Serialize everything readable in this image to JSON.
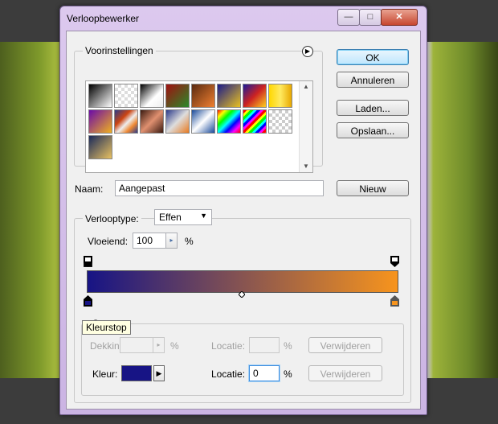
{
  "window": {
    "title": "Verloopbewerker"
  },
  "presets": {
    "legend": "Voorinstellingen",
    "menu_icon": "circle-arrow-icon",
    "swatches": [
      "linear-gradient(135deg,#000 0%,#fff 100%)",
      "repeating-conic-gradient(#ddd 0% 25%, #fff 0% 50%) 0 0/8px 8px",
      "linear-gradient(135deg,#000 0%,#fff 60%, #eee 100%)",
      "linear-gradient(135deg,#a01010 0%,#2a8a2a 100%)",
      "linear-gradient(135deg,#5a2a10 0%,#f08030 100%)",
      "linear-gradient(135deg,#1a1a8a 0%,#e8c020 100%)",
      "linear-gradient(135deg,#1a1a9a 0%,#c22 50%,#ffd020 100%)",
      "linear-gradient(90deg,#ffd700 0%,#ffea60 50%,#e8a800 100%)",
      "linear-gradient(135deg,#6a0aa8 0%,#f0b020 100%)",
      "linear-gradient(135deg,#2a3a8a 0%,#c41 35%,#eee 55%,#e83 75%,#2a3a8a 100%)",
      "linear-gradient(135deg,#3a1a10 0%,#e09070 50%,#3a1a10 100%)",
      "linear-gradient(135deg,#2a3a8a 0%,#ddd 50%,#e87a20 100%)",
      "linear-gradient(135deg,#1a4a9a 0%,#fff 50%,#1a4a9a 100%)",
      "linear-gradient(135deg,#f00,#ff0,#0f0,#0ff,#00f,#f0f,#f00)",
      "repeating-linear-gradient(135deg,#f00 0 3px,#ff0 3px 6px,#0f0 6px 9px,#0ff 9px 12px,#00f 12px 15px,#f0f 15px 18px)",
      "repeating-conic-gradient(#ccc 0% 25%, #fff 0% 50%) 0 0/8px 8px",
      "linear-gradient(135deg,#1a2a5a 0%,#e8c060 100%)"
    ]
  },
  "buttons": {
    "ok": "OK",
    "cancel": "Annuleren",
    "load": "Laden...",
    "save": "Opslaan...",
    "new": "Nieuw",
    "remove1": "Verwijderen",
    "remove2": "Verwijderen"
  },
  "name": {
    "label": "Naam:",
    "value": "Aangepast"
  },
  "gradient": {
    "type_label": "Verlooptype:",
    "type_value": "Effen",
    "smoothness_label": "Vloeiend:",
    "smoothness_value": "100",
    "percent": "%",
    "start_color": "#171485",
    "end_color": "#f7941d"
  },
  "stops": {
    "legend": "St",
    "tooltip": "Kleurstop",
    "opacity_label": "Dekking:",
    "opacity_pct": "%",
    "location_label1": "Locatie:",
    "location_pct1": "%",
    "color_label": "Kleur:",
    "location_label2": "Locatie:",
    "location_value2": "0",
    "location_pct2": "%",
    "color_value": "#171485"
  }
}
